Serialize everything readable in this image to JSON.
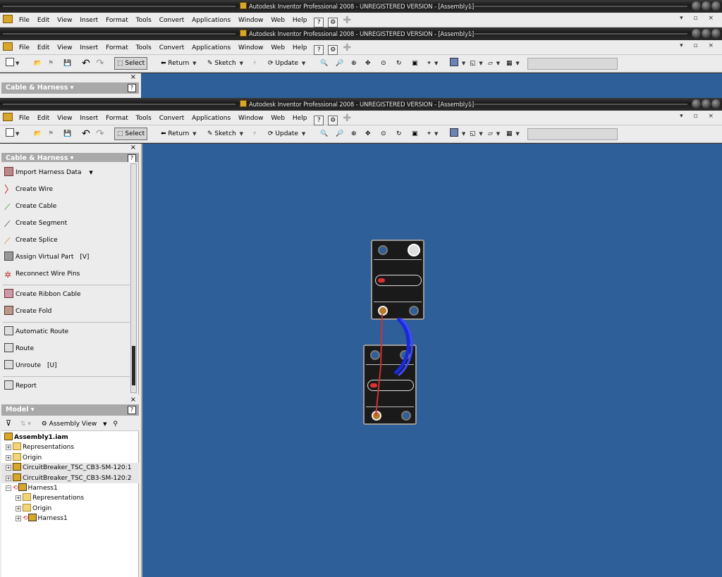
{
  "window": {
    "title": "Autodesk Inventor Professional 2008 - UNREGISTERED VERSION - [Assembly1]"
  },
  "menu": [
    "File",
    "Edit",
    "View",
    "Insert",
    "Format",
    "Tools",
    "Convert",
    "Applications",
    "Window",
    "Web",
    "Help"
  ],
  "toolbar": {
    "select": "Select",
    "return": "Return",
    "sketch": "Sketch",
    "update": "Update"
  },
  "panel": {
    "title": "Cable & Harness",
    "help": "?",
    "commands": [
      {
        "label": "Import Harness Data"
      },
      {
        "label": "Create Wire"
      },
      {
        "label": "Create Cable"
      },
      {
        "label": "Create Segment"
      },
      {
        "label": "Create Splice"
      },
      {
        "label": "Assign Virtual Part",
        "shortcut": "[V]"
      },
      {
        "label": "Reconnect Wire Pins"
      },
      {
        "label": "Create Ribbon Cable"
      },
      {
        "label": "Create Fold"
      },
      {
        "label": "Automatic Route"
      },
      {
        "label": "Route"
      },
      {
        "label": "Unroute",
        "shortcut": "[U]"
      },
      {
        "label": "Report"
      }
    ]
  },
  "model": {
    "title": "Model",
    "view": "Assembly View",
    "tree": [
      {
        "label": "Assembly1.iam"
      },
      {
        "label": "Representations"
      },
      {
        "label": "Origin"
      },
      {
        "label": "CircuitBreaker_TSC_CB3-SM-120:1"
      },
      {
        "label": "CircuitBreaker_TSC_CB3-SM-120:2"
      },
      {
        "label": "Harness1"
      },
      {
        "label": "Representations"
      },
      {
        "label": "Origin"
      },
      {
        "label": "Harness1"
      }
    ]
  },
  "colors": {
    "viewport": "#2f5f98",
    "wire_red": "#d03030",
    "wire_blue": "#1a2ad8"
  }
}
